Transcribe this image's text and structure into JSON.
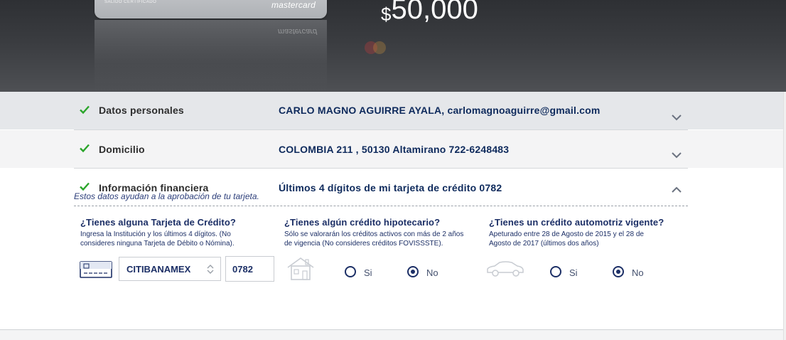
{
  "header": {
    "card_brand": "mastercard",
    "card_reflection_brand": "mastercard",
    "card_embossed": "SALIDO CERTIFICADO",
    "currency_symbol": "$",
    "amount": "50,000"
  },
  "sections": [
    {
      "title": "Datos personales",
      "value": "CARLO MAGNO AGUIRRE AYALA, carlomagnoaguirre@gmail.com",
      "expanded": false
    },
    {
      "title": "Domicilio",
      "value": "COLOMBIA 211 , 50130 Altamirano 722-6248483",
      "expanded": false
    },
    {
      "title": "Información financiera",
      "value": "Últimos 4 dígitos de mi tarjeta de crédito 0782",
      "note": "Estos datos ayudan a la aprobación de tu tarjeta.",
      "expanded": true
    }
  ],
  "questions": {
    "credit_card": {
      "title": "¿Tienes alguna Tarjeta de Crédito?",
      "help_line1": "Ingresa la Institución y los últimos 4 dígitos. (No",
      "help_line2": "consideres ninguna Tarjeta de Débito o Nómina).",
      "institution": "CITIBANAMEX",
      "last4": "0782"
    },
    "mortgage": {
      "title": "¿Tienes algún crédito hipotecario?",
      "help_line1": "Sólo se valorarán los créditos activos con más de 2 años",
      "help_line2": "de vigencia (No consideres créditos FOVISSSTE).",
      "yes_label": "Si",
      "no_label": "No",
      "selected": "No"
    },
    "auto": {
      "title": "¿Tienes un crédito automotriz vigente?",
      "help_line1": "Apeturado entre 28 de Agosto de 2015 y el 28 de",
      "help_line2": "Agosto de 2017 (últimos dos años)",
      "yes_label": "Si",
      "no_label": "No",
      "selected": "No"
    }
  },
  "colors": {
    "accent": "#1c2f66",
    "check": "#2aa52a",
    "header_bg": "#3a3c40"
  }
}
